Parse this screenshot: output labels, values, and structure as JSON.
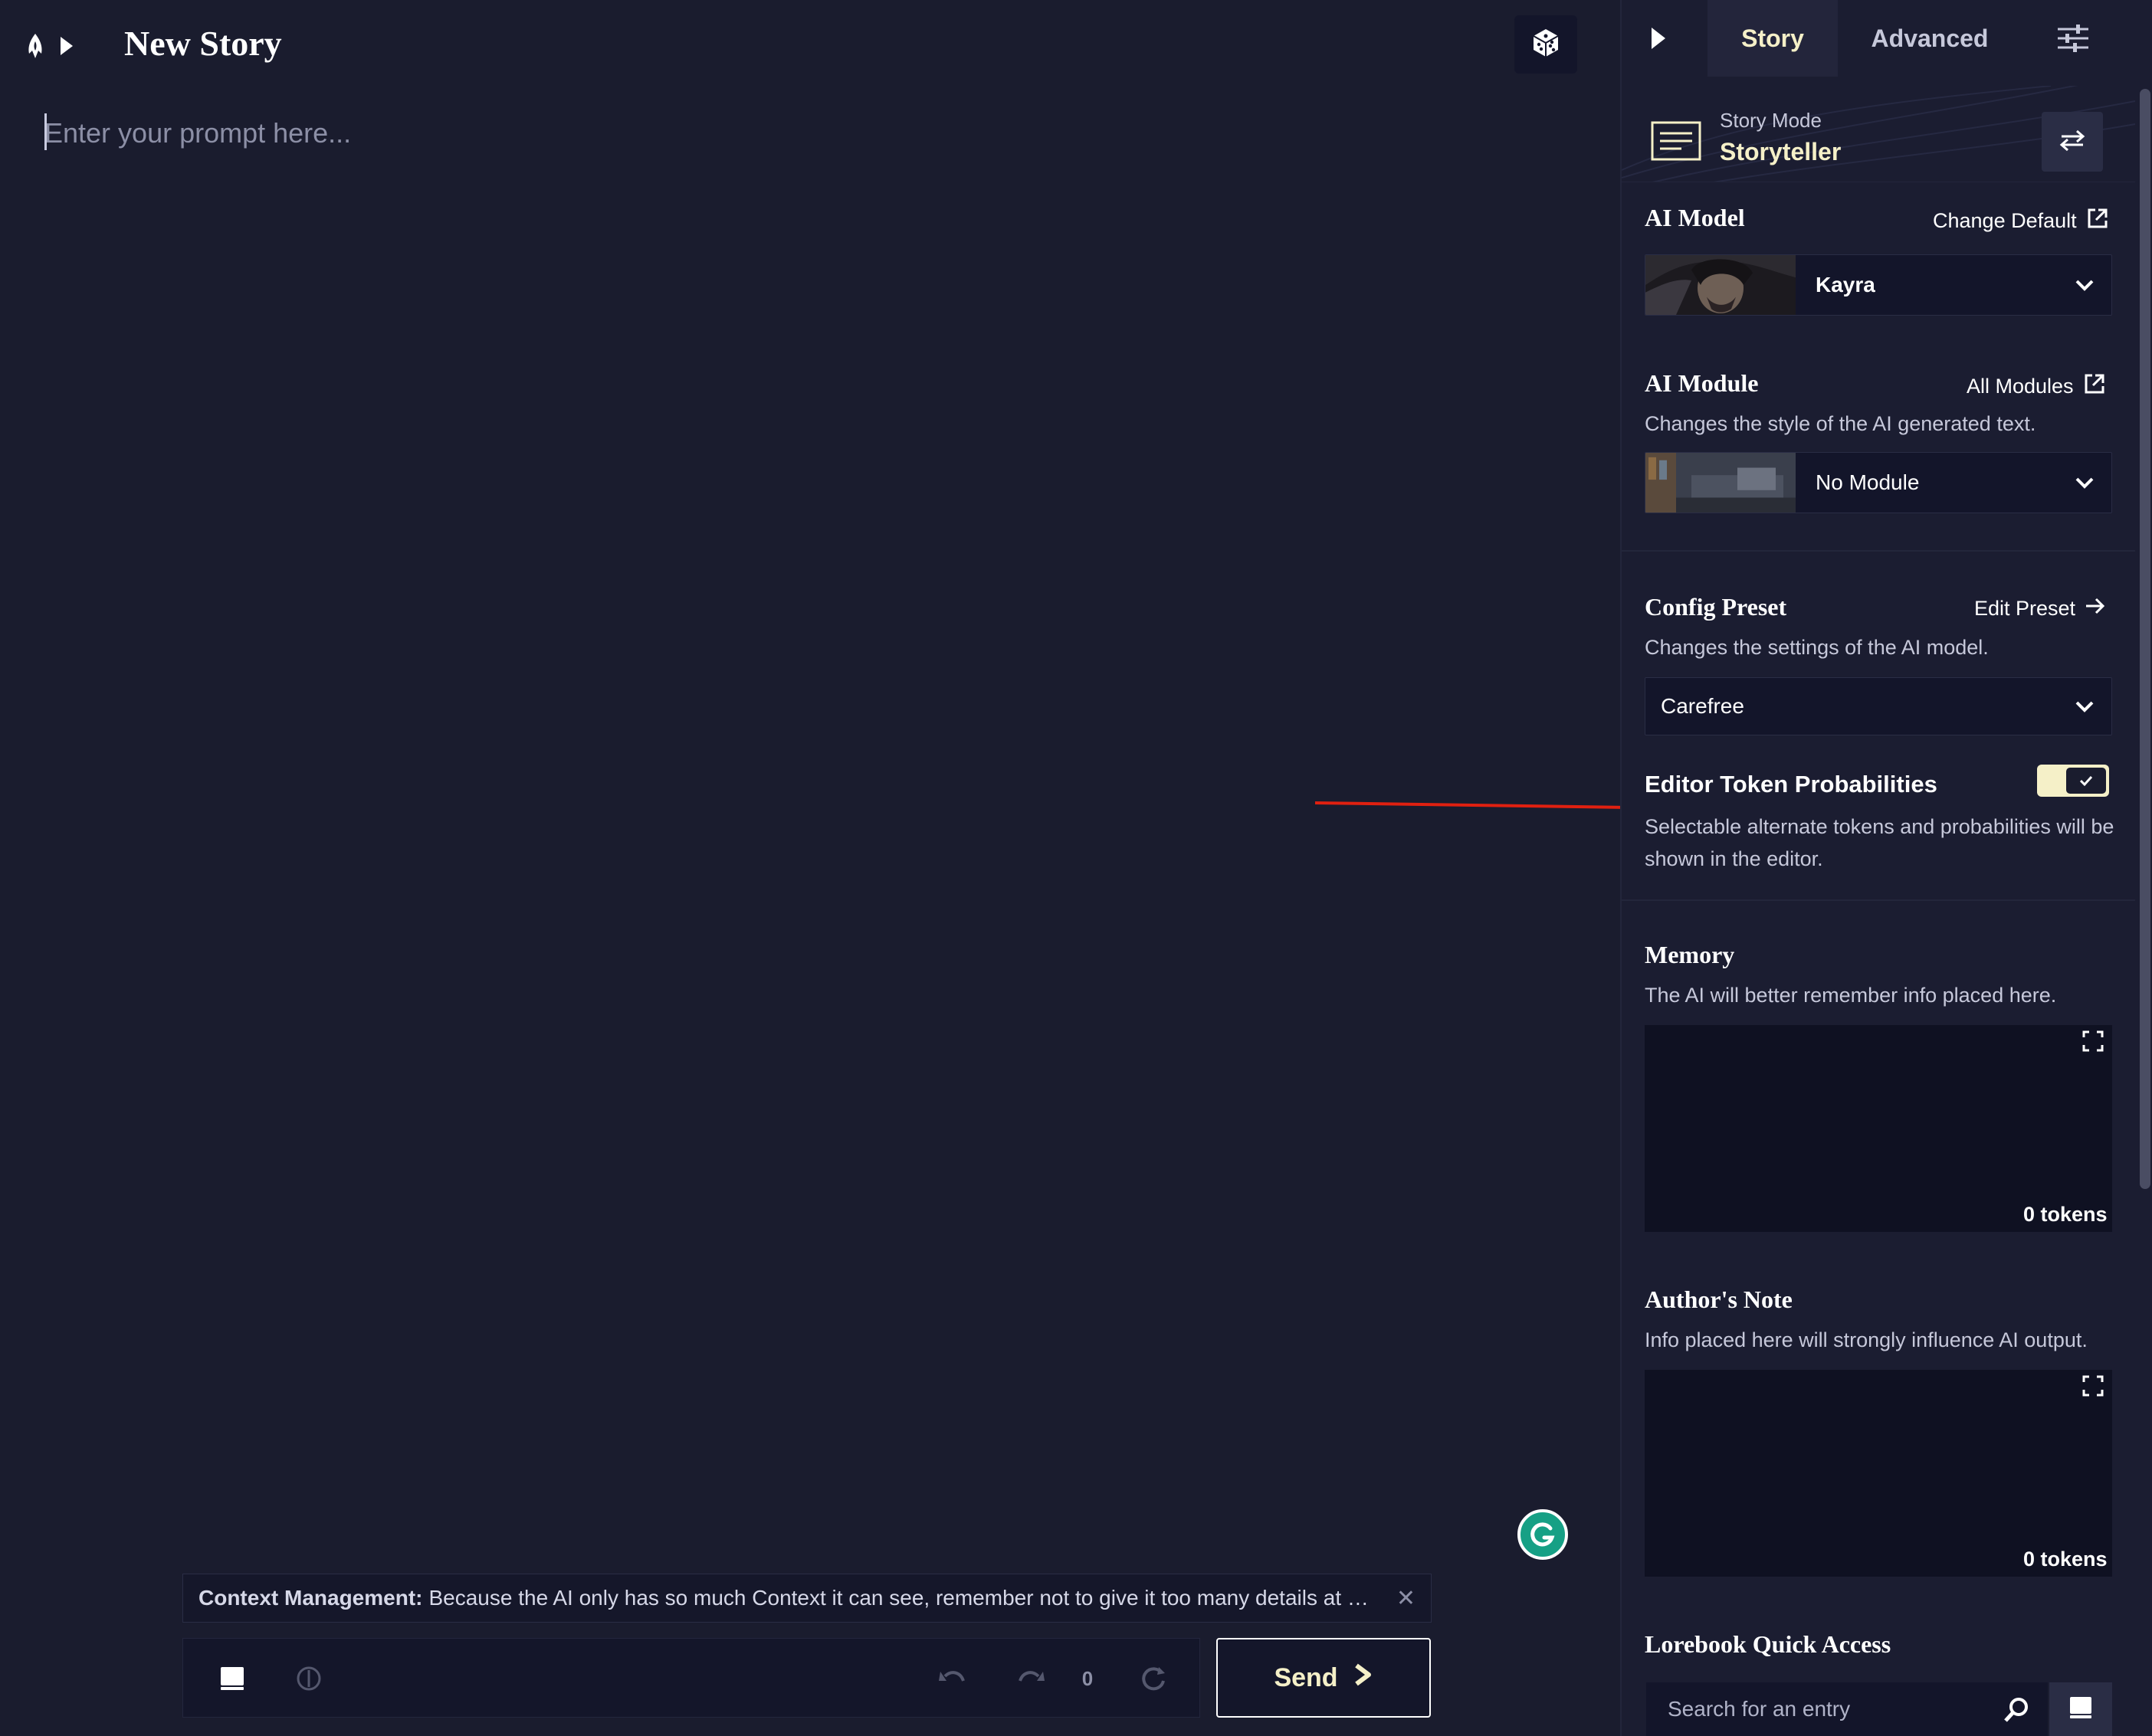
{
  "header": {
    "title": "New Story",
    "icons": [
      "quill-logo-icon",
      "play-icon",
      "dice-icon"
    ]
  },
  "editor": {
    "placeholder": "Enter your prompt here..."
  },
  "tip": {
    "label": "Context Management:",
    "text": "Because the AI only has so much Context it can see, remember not to give it too many details at once. Les…",
    "close": "✕"
  },
  "controls": {
    "retry_count": "0",
    "send_label": "Send"
  },
  "sidebar": {
    "tabs": {
      "story": "Story",
      "advanced": "Advanced"
    },
    "story_mode": {
      "label": "Story Mode",
      "value": "Storyteller"
    },
    "ai_model": {
      "title": "AI Model",
      "link": "Change Default",
      "selected": "Kayra"
    },
    "ai_module": {
      "title": "AI Module",
      "link": "All Modules",
      "description": "Changes the style of the AI generated text.",
      "selected": "No Module"
    },
    "config_preset": {
      "title": "Config Preset",
      "link": "Edit Preset",
      "description": "Changes the settings of the AI model.",
      "selected": "Carefree"
    },
    "token_probabilities": {
      "title": "Editor Token Probabilities",
      "description_line1": "Selectable alternate tokens and probabilities will be",
      "description_line2": "shown in the editor.",
      "enabled": true
    },
    "memory": {
      "title": "Memory",
      "description": "The AI will better remember info placed here.",
      "tokens": "0 tokens"
    },
    "authors_note": {
      "title": "Author's Note",
      "description": "Info placed here will strongly influence AI output.",
      "tokens": "0 tokens"
    },
    "lorebook": {
      "title": "Lorebook Quick Access",
      "search_placeholder": "Search for an entry"
    }
  },
  "colors": {
    "background": "#1a1c2e",
    "sidebar": "#1b1d31",
    "accent": "#f5f0c8",
    "annotation_arrow": "#e02010",
    "grammarly": "#16a085"
  }
}
